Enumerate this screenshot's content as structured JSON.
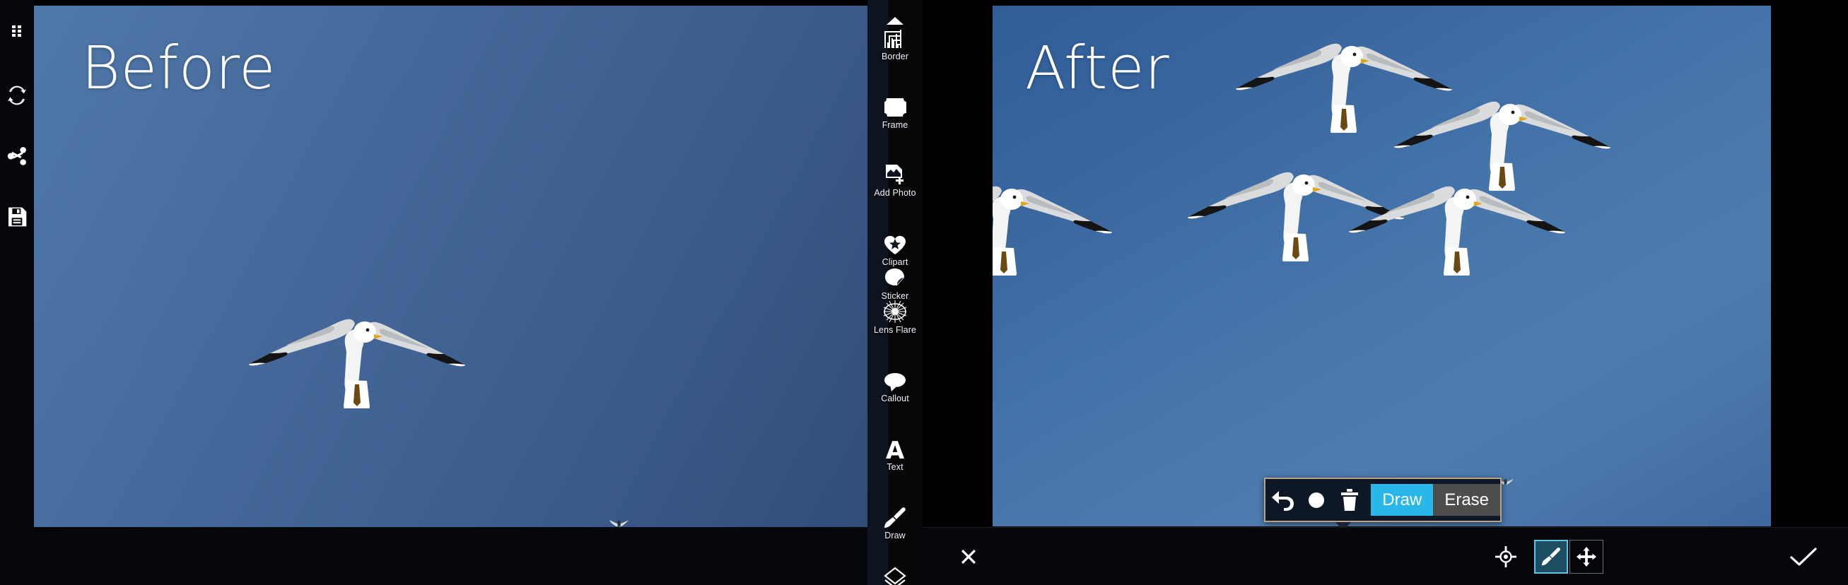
{
  "app": {
    "name": "photo-editor",
    "accent_color": "#29b6e8",
    "popup_border_color": "#b9a383",
    "bar_background": "#05070b"
  },
  "left_rail": {
    "items": [
      {
        "name": "menu-icon",
        "label": "Menu"
      },
      {
        "name": "refresh-icon",
        "label": "Refresh"
      },
      {
        "name": "share-icon",
        "label": "Share"
      },
      {
        "name": "save-icon",
        "label": "Save"
      }
    ],
    "close": {
      "name": "close-icon",
      "label": "Close"
    }
  },
  "before_panel": {
    "label": "Before",
    "sky_color": "#45699b"
  },
  "after_panel": {
    "label": "After",
    "sky_color": "#3f6ca4"
  },
  "tool_sidebar": {
    "scroll_indicator": "scroll-up-arrow",
    "tools": [
      {
        "label": "Border",
        "icon": "border-icon"
      },
      {
        "label": "Frame",
        "icon": "frame-icon"
      },
      {
        "label": "Add Photo",
        "icon": "add-photo-icon"
      },
      {
        "label": "Clipart",
        "icon": "clipart-icon"
      },
      {
        "label": "Sticker",
        "icon": "sticker-icon"
      },
      {
        "label": "Lens Flare",
        "icon": "lens-flare-icon"
      },
      {
        "label": "Callout",
        "icon": "callout-icon"
      },
      {
        "label": "Text",
        "icon": "text-icon"
      },
      {
        "label": "Draw",
        "icon": "draw-icon"
      }
    ],
    "partial_tool": {
      "label": "",
      "icon": "layers-diamond-icon"
    }
  },
  "draw_popup": {
    "undo": {
      "icon": "undo-icon",
      "label": "Undo"
    },
    "brush_size": {
      "icon": "circle-dot-icon",
      "label": "Brush Size"
    },
    "delete": {
      "icon": "trash-icon",
      "label": "Delete"
    },
    "modes": [
      {
        "label": "Draw",
        "selected": true
      },
      {
        "label": "Erase",
        "selected": false
      }
    ]
  },
  "bottom_bar": {
    "cancel": {
      "icon": "close-icon",
      "label": "Cancel"
    },
    "target": {
      "icon": "target-crosshair-icon",
      "label": "Target"
    },
    "brush_mode": {
      "icon": "brush-icon",
      "label": "Brush",
      "selected": true
    },
    "move_mode": {
      "icon": "move-arrows-icon",
      "label": "Move",
      "selected": false
    },
    "confirm": {
      "icon": "checkmark-icon",
      "label": "Apply"
    }
  }
}
